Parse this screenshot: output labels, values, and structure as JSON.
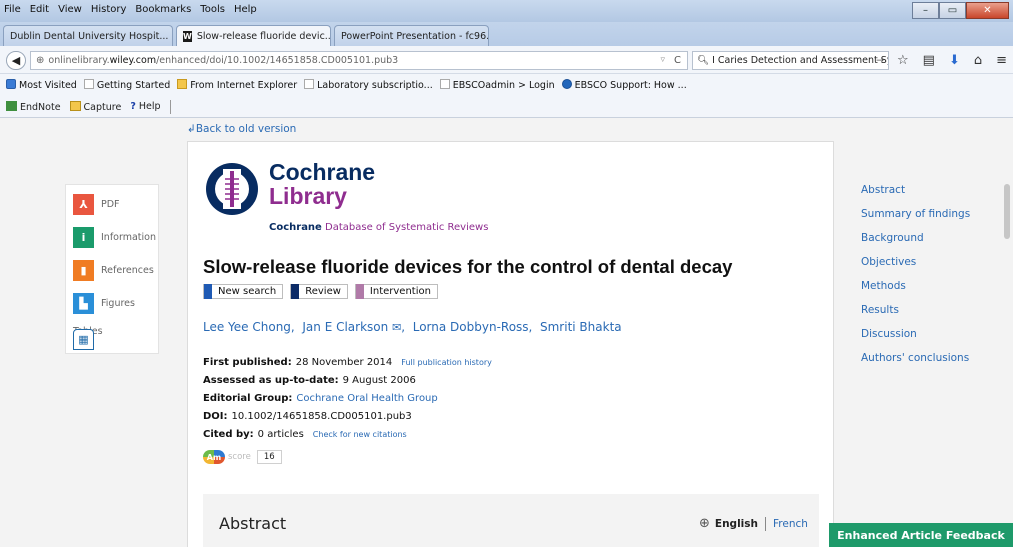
{
  "browser": {
    "menu": [
      "File",
      "Edit",
      "View",
      "History",
      "Bookmarks",
      "Tools",
      "Help"
    ],
    "tabs": [
      {
        "title": "Dublin Dental University Hospit...",
        "active": false
      },
      {
        "title": "Slow-release fluoride devic...",
        "active": true
      },
      {
        "title": "PowerPoint Presentation - fc96...",
        "active": false
      }
    ],
    "new_tab": "+",
    "url": {
      "domain_prefix": "onlinelibrary.",
      "domain": "wiley.com",
      "path": "/enhanced/doi/10.1002/14651858.CD005101.pub3"
    },
    "search": "I Caries Detection and Assessment System",
    "bookmarks": [
      "Most Visited",
      "Getting Started",
      "From Internet Explorer",
      "Laboratory subscriptio...",
      "EBSCOadmin > Login",
      "EBSCO Support: How ..."
    ],
    "toolbar2": [
      "EndNote",
      "Capture",
      "Help"
    ]
  },
  "page": {
    "back_link": "Back to old version",
    "left_nav": [
      {
        "label": "PDF",
        "icon": "pdf-icon"
      },
      {
        "label": "Information",
        "icon": "information-icon"
      },
      {
        "label": "References",
        "icon": "references-icon"
      },
      {
        "label": "Figures",
        "icon": "figures-icon"
      },
      {
        "label": "Tables",
        "icon": "tables-icon"
      }
    ],
    "logo": {
      "line1": "Cochrane",
      "line2": "Library"
    },
    "cdsr": {
      "bold": "Cochrane",
      "rest": " Database of Systematic Reviews"
    },
    "title": "Slow-release fluoride devices for the control of dental decay",
    "tags": [
      {
        "label": "New search",
        "color": "#1f5ab4"
      },
      {
        "label": "Review",
        "color": "#0c2b66"
      },
      {
        "label": "Intervention",
        "color": "#b07aa8"
      }
    ],
    "authors": [
      "Lee Yee Chong,",
      "Jan E Clarkson",
      "Lorna Dobbyn-Ross,",
      "Smriti Bhakta"
    ],
    "meta": {
      "first_published_label": "First published:",
      "first_published_value": "28 November 2014",
      "full_history": "Full publication history",
      "assessed_label": "Assessed as up-to-date:",
      "assessed_value": "9 August 2006",
      "editorial_label": "Editorial Group:",
      "editorial_value": "Cochrane Oral Health Group",
      "doi_label": "DOI:",
      "doi_value": "10.1002/14651858.CD005101.pub3",
      "cited_label": "Cited by:",
      "cited_value": "0 articles",
      "check_citations": "Check for new citations"
    },
    "altmetric": {
      "badge": "Am",
      "label": "score",
      "score": "16"
    },
    "abstract": {
      "heading": "Abstract",
      "lang_current": "English",
      "lang_other": "French"
    },
    "toc": [
      "Abstract",
      "Summary of findings",
      "Background",
      "Objectives",
      "Methods",
      "Results",
      "Discussion",
      "Authors' conclusions"
    ],
    "feedback": "Enhanced Article Feedback"
  }
}
